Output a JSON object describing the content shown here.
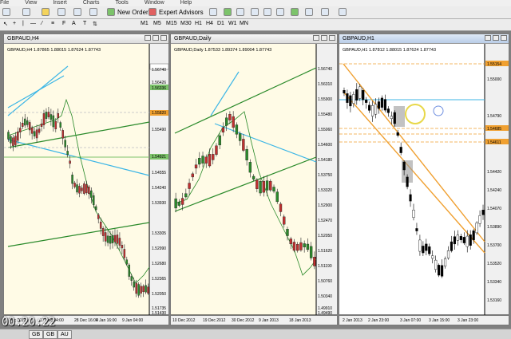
{
  "menu": [
    "File",
    "View",
    "Insert",
    "Charts",
    "Tools",
    "Window",
    "Help"
  ],
  "toolbar": {
    "new_order": "New Order",
    "expert_advisors": "Expert Advisors"
  },
  "timeframes": [
    "M1",
    "M5",
    "M15",
    "M30",
    "H1",
    "H4",
    "D1",
    "W1",
    "MN"
  ],
  "windows": [
    {
      "title": "GBPAUD,H4",
      "info": "GBPAUD,H4  1.87865 1.88015 1.87624 1.87743",
      "prices": [
        "1.56740",
        "1.56426",
        "1.56336",
        "1.55820",
        "1.55490",
        "1.54921",
        "1.54555",
        "1.54240",
        "1.53930",
        "1.53305",
        "1.52990",
        "1.52680",
        "1.52365",
        "1.52050",
        "1.51735",
        "1.51430"
      ],
      "dates": [
        "2 Dec 2012",
        "17 Dec 04:00",
        "28 Dec 16:00",
        "4 Jan 16:00",
        "9 Jan 04:00"
      ]
    },
    {
      "title": "GBPAUD,Daily",
      "info": "GBPAUD,Daily  1.87533 1.89374 1.89004 1.87743",
      "prices": [
        "1.56740",
        "1.56310",
        "1.55900",
        "1.55480",
        "1.55060",
        "1.54600",
        "1.54180",
        "1.53750",
        "1.53320",
        "1.52900",
        "1.52470",
        "1.52050",
        "1.51620",
        "1.51190",
        "1.50760",
        "1.50340",
        "1.49910",
        "1.49490"
      ],
      "dates": [
        "10 Dec 2012",
        "19 Dec 2012",
        "30 Dec 2012",
        "9 Jan 2013",
        "18 Jan 2013"
      ]
    },
    {
      "title": "GBPAUD,H1",
      "info": "GBPAUD,H1  1.87812 1.88015 1.87624 1.87743",
      "prices": [
        "1.55154",
        "1.55000",
        "1.54790",
        "1.54685",
        "1.54611",
        "1.54420",
        "1.54240",
        "1.54070",
        "1.53890",
        "1.53700",
        "1.53520",
        "1.53340",
        "1.53160"
      ],
      "dates": [
        "2 Jan 2013",
        "2 Jan 23:00",
        "3 Jan 07:00",
        "3 Jan 15:00",
        "3 Jan 23:00"
      ]
    }
  ],
  "timecode": "00:20:22",
  "status_tabs": [
    "GB",
    "GB",
    "AU"
  ]
}
